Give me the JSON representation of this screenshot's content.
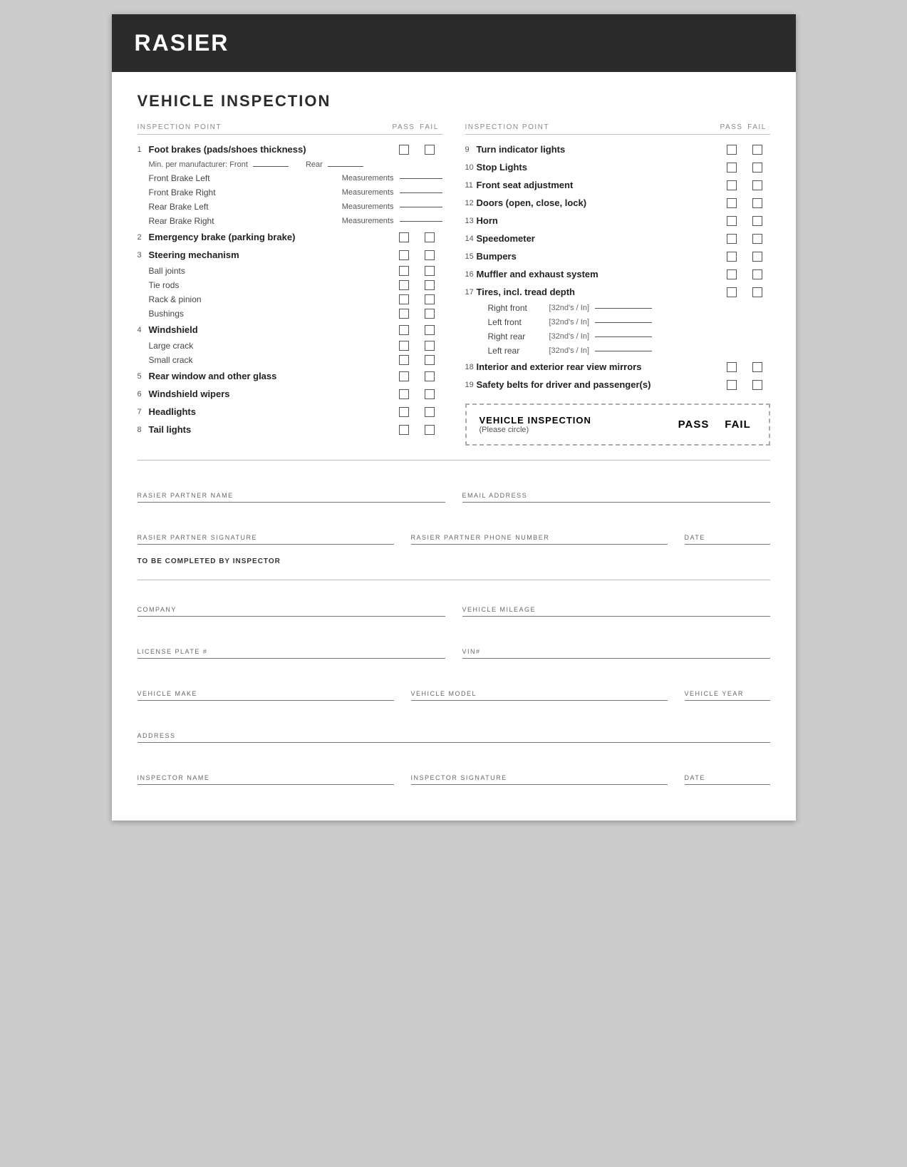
{
  "header": {
    "title": "RASIER"
  },
  "form_title": "VEHICLE INSPECTION",
  "col_headers": {
    "inspection_point": "INSPECTION POINT",
    "pass": "PASS",
    "fail": "FAIL"
  },
  "left_items": [
    {
      "num": "1",
      "label": "Foot brakes (pads/shoes thickness)",
      "bold": true,
      "has_checkbox": true,
      "sub": [
        {
          "type": "front_rear",
          "text": "Min. per manufacturer:  Front",
          "text2": "Rear"
        },
        {
          "type": "meas",
          "label": "Front Brake Left",
          "measure": "Measurements"
        },
        {
          "type": "meas",
          "label": "Front Brake Right",
          "measure": "Measurements"
        },
        {
          "type": "meas",
          "label": "Rear Brake Left",
          "measure": "Measurements"
        },
        {
          "type": "meas",
          "label": "Rear Brake Right",
          "measure": "Measurements"
        }
      ]
    },
    {
      "num": "2",
      "label": "Emergency brake (parking brake)",
      "bold": true,
      "has_checkbox": true
    },
    {
      "num": "3",
      "label": "Steering mechanism",
      "bold": true,
      "has_checkbox": true,
      "sub": [
        {
          "type": "sub_check",
          "label": "Ball joints"
        },
        {
          "type": "sub_check",
          "label": "Tie rods"
        },
        {
          "type": "sub_check",
          "label": "Rack & pinion"
        },
        {
          "type": "sub_check",
          "label": "Bushings"
        }
      ]
    },
    {
      "num": "4",
      "label": "Windshield",
      "bold": true,
      "has_checkbox": true,
      "sub": [
        {
          "type": "sub_check",
          "label": "Large crack"
        },
        {
          "type": "sub_check",
          "label": "Small crack"
        }
      ]
    },
    {
      "num": "5",
      "label": "Rear window and other glass",
      "bold": true,
      "has_checkbox": true
    },
    {
      "num": "6",
      "label": "Windshield wipers",
      "bold": true,
      "has_checkbox": true
    },
    {
      "num": "7",
      "label": "Headlights",
      "bold": true,
      "has_checkbox": true
    },
    {
      "num": "8",
      "label": "Tail lights",
      "bold": true,
      "has_checkbox": true
    }
  ],
  "right_items": [
    {
      "num": "9",
      "label": "Turn indicator lights",
      "bold": true,
      "has_checkbox": true
    },
    {
      "num": "10",
      "label": "Stop Lights",
      "bold": true,
      "has_checkbox": true
    },
    {
      "num": "11",
      "label": "Front seat adjustment",
      "bold": true,
      "has_checkbox": true
    },
    {
      "num": "12",
      "label": "Doors (open, close, lock)",
      "bold": true,
      "has_checkbox": true
    },
    {
      "num": "13",
      "label": "Horn",
      "bold": true,
      "has_checkbox": true
    },
    {
      "num": "14",
      "label": "Speedometer",
      "bold": true,
      "has_checkbox": true
    },
    {
      "num": "15",
      "label": "Bumpers",
      "bold": true,
      "has_checkbox": true
    },
    {
      "num": "16",
      "label": "Muffler and exhaust system",
      "bold": true,
      "has_checkbox": true
    },
    {
      "num": "17",
      "label": "Tires, incl. tread depth",
      "bold": true,
      "has_checkbox": true,
      "sub": [
        {
          "type": "tread",
          "label": "Right front",
          "unit": "[32nd's / In]"
        },
        {
          "type": "tread",
          "label": "Left front",
          "unit": "[32nd's / In]"
        },
        {
          "type": "tread",
          "label": "Right rear",
          "unit": "[32nd's / In]"
        },
        {
          "type": "tread",
          "label": "Left rear",
          "unit": "[32nd's / In]"
        }
      ]
    },
    {
      "num": "18",
      "label": "Interior and exterior rear view mirrors",
      "bold": true,
      "has_checkbox": true
    },
    {
      "num": "19",
      "label": "Safety belts for driver and passenger(s)",
      "bold": true,
      "has_checkbox": true
    }
  ],
  "summary": {
    "title": "VEHICLE INSPECTION",
    "subtitle": "(Please circle)",
    "pass": "PASS",
    "fail": "FAIL"
  },
  "form_fields": {
    "partner_name_label": "RASIER PARTNER NAME",
    "email_label": "EMAIL ADDRESS",
    "signature_label": "RASIER PARTNER SIGNATURE",
    "phone_label": "RASIER PARTNER PHONE NUMBER",
    "date_label": "DATE",
    "completed_by": "TO BE COMPLETED BY INSPECTOR",
    "company_label": "COMPANY",
    "mileage_label": "VEHICLE MILEAGE",
    "license_label": "LICENSE PLATE #",
    "vin_label": "VIN#",
    "make_label": "VEHICLE MAKE",
    "model_label": "VEHICLE MODEL",
    "year_label": "VEHICLE YEAR",
    "address_label": "ADDRESS",
    "inspector_name_label": "INSPECTOR NAME",
    "inspector_sig_label": "INSPECTOR SIGNATURE",
    "inspector_date_label": "DATE"
  }
}
